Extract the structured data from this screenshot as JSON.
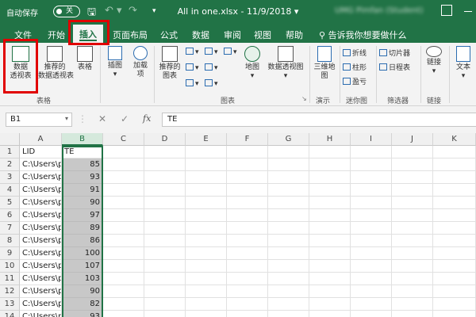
{
  "titlebar": {
    "autosave_label": "自动保存",
    "autosave_state": "关",
    "save_icon": "save-icon",
    "undo_icon": "undo-icon",
    "redo_icon": "redo-icon",
    "qa_more": "▾",
    "document_title": "All in one.xlsx  -  11/9/2018  ▾",
    "user_name": "UMG Pimfan (Student)",
    "bg_color": "#217346"
  },
  "tabs": [
    "文件",
    "开始",
    "插入",
    "页面布局",
    "公式",
    "数据",
    "审阅",
    "视图",
    "帮助"
  ],
  "active_tab": "插入",
  "tell_me": "告诉我你想要做什么",
  "ribbon": {
    "pivot_table": "数据\n透视表",
    "recommended_pivot": "推荐的\n数据透视表",
    "table": "表格",
    "illustrations": "插图",
    "addins": "加载\n项",
    "recommended_charts": "推荐的\n图表",
    "map": "地图",
    "pivot_chart": "数据透视图",
    "map3d": "三维地\n图",
    "spark_line": "折线",
    "spark_column": "柱形",
    "spark_winloss": "盈亏",
    "slicer": "切片器",
    "timeline": "日程表",
    "link": "链接",
    "text": "文本",
    "groups": {
      "tables": "表格",
      "charts": "图表",
      "tours": "演示",
      "sparklines": "迷你图",
      "filters": "筛选器",
      "links": "链接"
    }
  },
  "formula_bar": {
    "name_box": "B1",
    "cancel": "✕",
    "enter": "✓",
    "fx": "fx",
    "content": "TE"
  },
  "columns": [
    "A",
    "B",
    "C",
    "D",
    "E",
    "F",
    "G",
    "H",
    "I",
    "J",
    "K"
  ],
  "rows": [
    {
      "n": "1",
      "a": "LID",
      "b": "TE"
    },
    {
      "n": "2",
      "a": "C:\\Users\\p",
      "b": "85"
    },
    {
      "n": "3",
      "a": "C:\\Users\\p",
      "b": "93"
    },
    {
      "n": "4",
      "a": "C:\\Users\\p",
      "b": "91"
    },
    {
      "n": "5",
      "a": "C:\\Users\\p",
      "b": "90"
    },
    {
      "n": "6",
      "a": "C:\\Users\\p",
      "b": "97"
    },
    {
      "n": "7",
      "a": "C:\\Users\\p",
      "b": "89"
    },
    {
      "n": "8",
      "a": "C:\\Users\\p",
      "b": "86"
    },
    {
      "n": "9",
      "a": "C:\\Users\\p",
      "b": "100"
    },
    {
      "n": "10",
      "a": "C:\\Users\\p",
      "b": "107"
    },
    {
      "n": "11",
      "a": "C:\\Users\\p",
      "b": "103"
    },
    {
      "n": "12",
      "a": "C:\\Users\\p",
      "b": "90"
    },
    {
      "n": "13",
      "a": "C:\\Users\\p",
      "b": "82"
    },
    {
      "n": "14",
      "a": "C:\\Users\\p",
      "b": "93"
    }
  ]
}
